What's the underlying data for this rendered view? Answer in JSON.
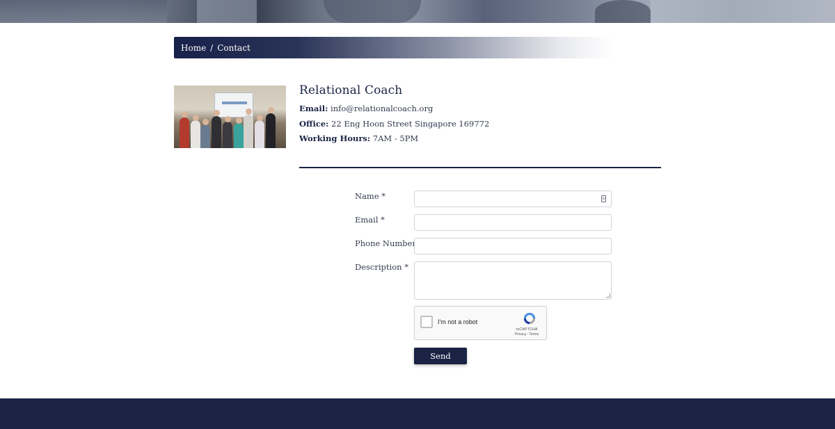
{
  "breadcrumb": {
    "home": "Home",
    "separator": "/",
    "current": "Contact"
  },
  "organization": {
    "name": "Relational Coach",
    "email_label": "Email:",
    "email": "info@relationalcoach.org",
    "office_label": "Office:",
    "office": "22 Eng Hoon Street Singapore 169772",
    "hours_label": "Working Hours:",
    "hours": "7AM - 5PM"
  },
  "form": {
    "name_label": "Name *",
    "email_label": "Email *",
    "phone_label": "Phone Number",
    "description_label": "Description *",
    "name_value": "",
    "email_value": "",
    "phone_value": "",
    "description_value": "",
    "send_label": "Send"
  },
  "recaptcha": {
    "checkbox_label": "I'm not a robot",
    "brand": "reCAPTCHA",
    "links": "Privacy - Terms"
  },
  "colors": {
    "primary": "#1a2344",
    "text": "#333a4d",
    "border": "#cfd3d9"
  },
  "icons": {
    "autofill": "contact-card-icon",
    "captcha_logo": "recaptcha-logo-icon"
  }
}
